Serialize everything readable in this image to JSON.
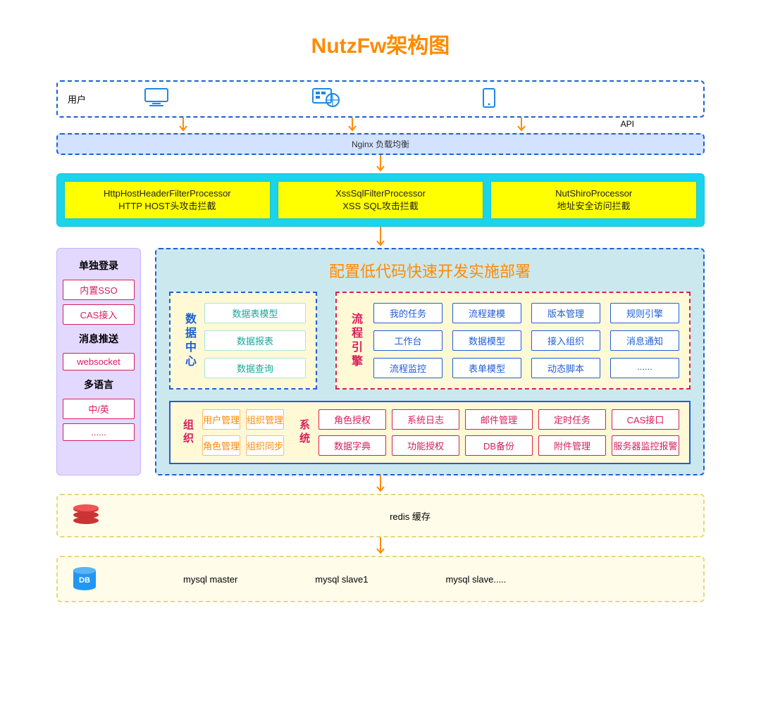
{
  "title": "NutzFw架构图",
  "clients": {
    "label": "用户",
    "api": "API"
  },
  "nginx": "Nginx 负载均衡",
  "processors": [
    {
      "name": "HttpHostHeaderFilterProcessor",
      "desc": "HTTP HOST头攻击拦截"
    },
    {
      "name": "XssSqlFilterProcessor",
      "desc": "XSS SQL攻击拦截"
    },
    {
      "name": "NutShiroProcessor",
      "desc": "地址安全访问拦截"
    }
  ],
  "sidebar": {
    "sso_hdr": "单独登录",
    "sso_items": [
      "内置SSO",
      "CAS接入"
    ],
    "msg_hdr": "消息推送",
    "msg_items": [
      "websocket"
    ],
    "lang_hdr": "多语言",
    "lang_items": [
      "中/英",
      "......"
    ]
  },
  "main": {
    "title": "配置低代码快速开发实施部署",
    "datacenter": {
      "label": "数据中心",
      "items": [
        "数据表模型",
        "数据报表",
        "数据查询"
      ]
    },
    "flow": {
      "label": "流程引擎",
      "items": [
        "我的任务",
        "流程建模",
        "版本管理",
        "规则引擎",
        "工作台",
        "数据模型",
        "接入组织",
        "消息通知",
        "流程监控",
        "表单模型",
        "动态脚本",
        "......"
      ]
    },
    "org": {
      "label": "组织",
      "items": [
        "用户管理",
        "组织管理",
        "角色管理",
        "组织同步"
      ]
    },
    "sys": {
      "label": "系统",
      "items": [
        "角色授权",
        "系统日志",
        "邮件管理",
        "定时任务",
        "CAS接口",
        "数据字典",
        "功能授权",
        "DB备份",
        "附件管理",
        "服务器监控报警"
      ]
    }
  },
  "redis": "redis 缓存",
  "db": {
    "items": [
      "mysql master",
      "mysql slave1",
      "mysql slave....."
    ],
    "label": "DB"
  }
}
